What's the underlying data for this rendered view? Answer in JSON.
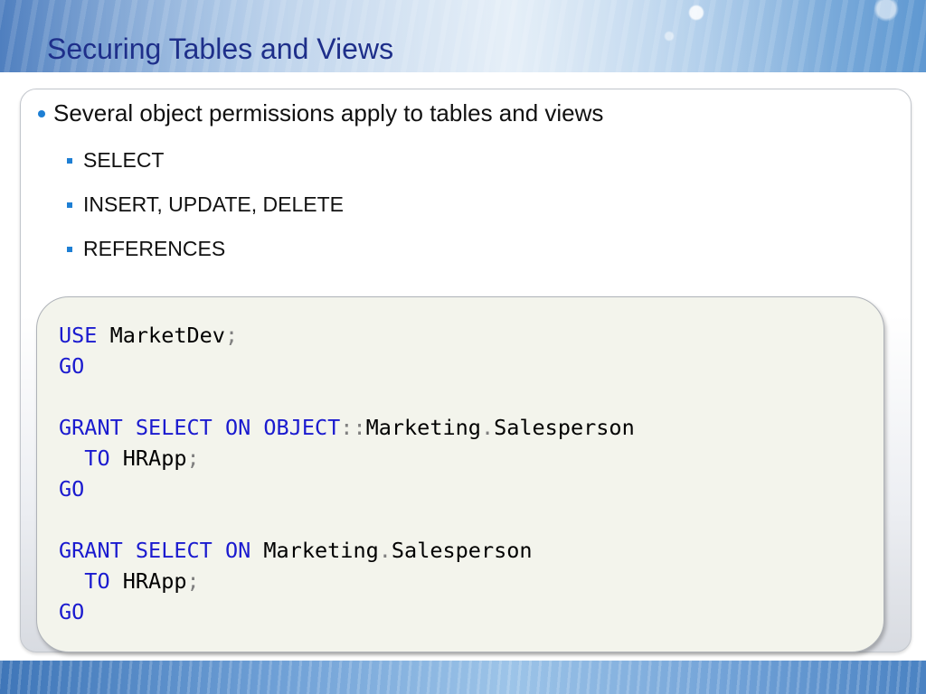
{
  "slide": {
    "title": "Securing Tables and Views",
    "bullet": "Several object permissions apply to tables and views",
    "sub_items": [
      "SELECT",
      "INSERT, UPDATE, DELETE",
      "REFERENCES"
    ]
  },
  "code": {
    "line1": {
      "kw1": "USE",
      "id1": "MarketDev",
      "p1": ";"
    },
    "line2": {
      "kw1": "GO"
    },
    "line3": {
      "kw1": "GRANT",
      "kw2": "SELECT",
      "kw3": "ON",
      "kw4": "OBJECT",
      "p1": "::",
      "id1": "Marketing",
      "p2": ".",
      "id2": "Salesperson"
    },
    "line4": {
      "kw1": "TO",
      "id1": "HRApp",
      "p1": ";"
    },
    "line5": {
      "kw1": "GO"
    },
    "line6": {
      "kw1": "GRANT",
      "kw2": "SELECT",
      "kw3": "ON",
      "id1": "Marketing",
      "p1": ".",
      "id2": "Salesperson"
    },
    "line7": {
      "kw1": "TO",
      "id1": "HRApp",
      "p1": ";"
    },
    "line8": {
      "kw1": "GO"
    }
  },
  "colors": {
    "title": "#1e2f8a",
    "keyword": "#1a1acf",
    "bullet": "#1e7fd4",
    "code_background": "#f3f4ec"
  }
}
